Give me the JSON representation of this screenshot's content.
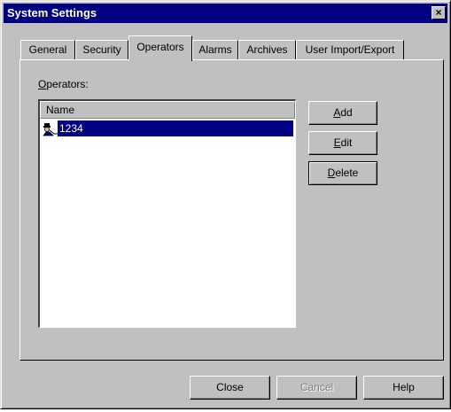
{
  "window": {
    "title": "System Settings",
    "close_glyph": "×"
  },
  "tabs": [
    {
      "label": "General",
      "active": false
    },
    {
      "label": "Security",
      "active": false
    },
    {
      "label": "Operators",
      "active": true
    },
    {
      "label": "Alarms",
      "active": false
    },
    {
      "label": "Archives",
      "active": false
    },
    {
      "label": "User Import/Export",
      "active": false
    }
  ],
  "operators": {
    "label_mnemonic": "O",
    "label_rest": "perators:",
    "column_header": "Name",
    "selected_index": 0,
    "items": [
      {
        "name": "1234",
        "icon": "operator-icon"
      }
    ]
  },
  "side_buttons": {
    "add": {
      "mnemonic": "A",
      "rest": "dd"
    },
    "edit": {
      "mnemonic": "E",
      "rest": "dit"
    },
    "delete": {
      "mnemonic": "D",
      "rest": "elete"
    }
  },
  "bottom_buttons": {
    "close": "Close",
    "cancel": "Cancel",
    "help": "Help"
  }
}
